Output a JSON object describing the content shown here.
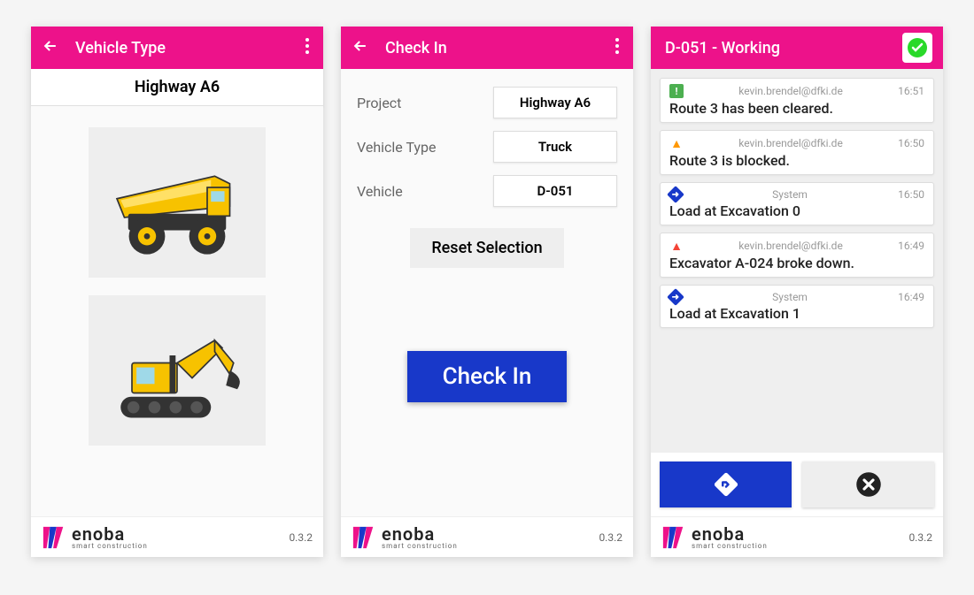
{
  "version": "0.3.2",
  "brand": {
    "name": "enoba",
    "tagline": "smart construction"
  },
  "screen1": {
    "appbar_title": "Vehicle Type",
    "subheader": "Highway A6",
    "vehicles": [
      "truck",
      "excavator"
    ]
  },
  "screen2": {
    "appbar_title": "Check In",
    "rows": [
      {
        "label": "Project",
        "value": "Highway A6"
      },
      {
        "label": "Vehicle Type",
        "value": "Truck"
      },
      {
        "label": "Vehicle",
        "value": "D-051"
      }
    ],
    "reset_label": "Reset Selection",
    "checkin_label": "Check In"
  },
  "screen3": {
    "appbar_title": "D-051 - Working",
    "messages": [
      {
        "icon": "ok-green",
        "sender": "kevin.brendel@dfki.de",
        "time": "16:51",
        "body": "Route 3 has been cleared."
      },
      {
        "icon": "warn-orange",
        "sender": "kevin.brendel@dfki.de",
        "time": "16:50",
        "body": "Route 3 is blocked."
      },
      {
        "icon": "nav-blue",
        "sender": "System",
        "time": "16:50",
        "body": "Load at Excavation 0"
      },
      {
        "icon": "warn-red",
        "sender": "kevin.brendel@dfki.de",
        "time": "16:49",
        "body": "Excavator A-024 broke down."
      },
      {
        "icon": "nav-blue",
        "sender": "System",
        "time": "16:49",
        "body": "Load at Excavation 1"
      }
    ]
  }
}
